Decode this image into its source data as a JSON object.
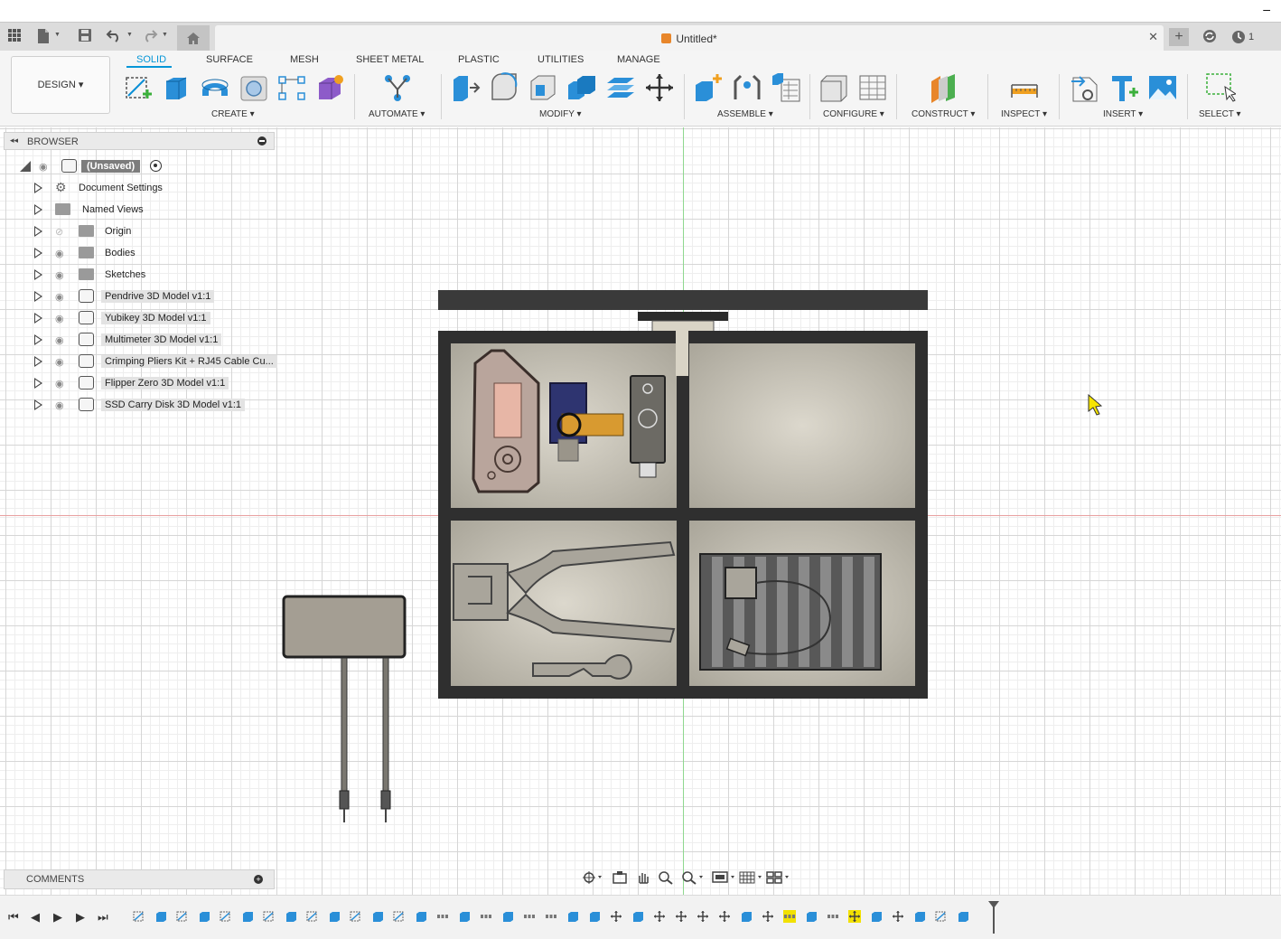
{
  "window": {
    "minimize_glyph": "–"
  },
  "appbar": {
    "doc_title": "Untitled*",
    "tab_close": "✕",
    "new_tab": "+",
    "notification_count": "1",
    "icons": [
      "apps-grid-icon",
      "file-icon",
      "save-icon",
      "undo-icon",
      "redo-icon",
      "home-icon",
      "sync-icon",
      "clock-icon"
    ]
  },
  "ribbon": {
    "workspace_button": "DESIGN ▾",
    "tabs": [
      {
        "label": "SOLID",
        "active": true
      },
      {
        "label": "SURFACE",
        "active": false
      },
      {
        "label": "MESH",
        "active": false
      },
      {
        "label": "SHEET METAL",
        "active": false
      },
      {
        "label": "PLASTIC",
        "active": false
      },
      {
        "label": "UTILITIES",
        "active": false
      },
      {
        "label": "MANAGE",
        "active": false
      }
    ],
    "groups": [
      {
        "label": "CREATE ▾"
      },
      {
        "label": "AUTOMATE ▾"
      },
      {
        "label": "MODIFY ▾"
      },
      {
        "label": "ASSEMBLE ▾"
      },
      {
        "label": "CONFIGURE ▾"
      },
      {
        "label": "CONSTRUCT ▾"
      },
      {
        "label": "INSPECT ▾"
      },
      {
        "label": "INSERT ▾"
      },
      {
        "label": "SELECT ▾"
      }
    ],
    "accent_color": "#0696d7"
  },
  "browser": {
    "title": "BROWSER",
    "collapse_glyph": "◂◂",
    "root": {
      "label": "(Unsaved)"
    },
    "items": [
      {
        "label": "Document Settings",
        "icon": "gear-icon"
      },
      {
        "label": "Named Views",
        "icon": "folder-icon"
      },
      {
        "label": "Origin",
        "icon": "folder-icon",
        "hidden": true
      },
      {
        "label": "Bodies",
        "icon": "folder-icon"
      },
      {
        "label": "Sketches",
        "icon": "folder-icon"
      },
      {
        "label": "Pendrive 3D Model v1:1",
        "icon": "component-icon"
      },
      {
        "label": "Yubikey 3D Model v1:1",
        "icon": "component-icon"
      },
      {
        "label": "Multimeter 3D Model v1:1",
        "icon": "component-icon"
      },
      {
        "label": "Crimping Pliers Kit + RJ45 Cable Cu...",
        "icon": "component-icon"
      },
      {
        "label": "Flipper Zero 3D Model v1:1",
        "icon": "component-icon"
      },
      {
        "label": "SSD Carry Disk 3D Model v1:1",
        "icon": "component-icon"
      }
    ]
  },
  "comments": {
    "title": "COMMENTS",
    "add_glyph": "+"
  },
  "timeline": {
    "controls": [
      "⏮",
      "◀",
      "▶",
      "▶",
      "⏭"
    ],
    "highlight_color": "#f2e100"
  }
}
